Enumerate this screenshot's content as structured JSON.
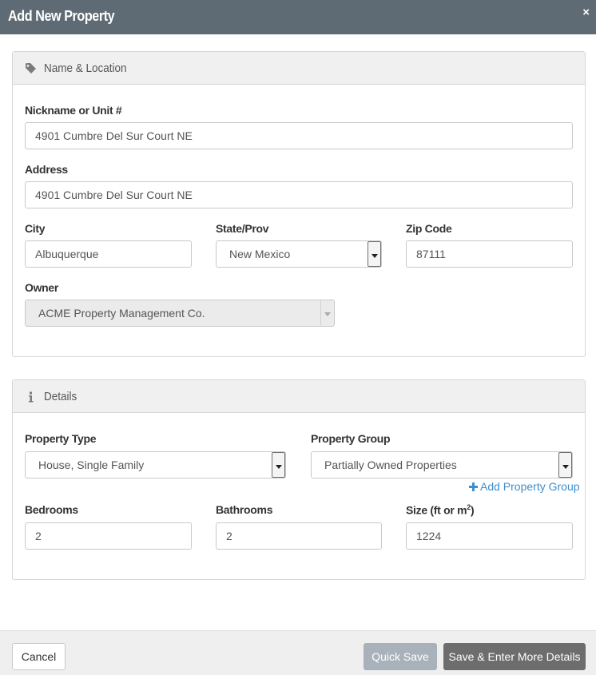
{
  "dialog": {
    "title": "Add New Property",
    "close_symbol": "×"
  },
  "section_location": {
    "title": "Name & Location",
    "icon": "tag-icon",
    "nickname": {
      "label": "Nickname or Unit #",
      "value": "4901 Cumbre Del Sur Court NE"
    },
    "address": {
      "label": "Address",
      "value": "4901 Cumbre Del Sur Court NE"
    },
    "city": {
      "label": "City",
      "value": "Albuquerque"
    },
    "state": {
      "label": "State/Prov",
      "value": "New Mexico"
    },
    "zip": {
      "label": "Zip Code",
      "value": "87111"
    },
    "owner": {
      "label": "Owner",
      "value": "ACME Property Management Co.",
      "disabled": true
    }
  },
  "section_details": {
    "title": "Details",
    "icon": "info-icon",
    "property_type": {
      "label": "Property Type",
      "value": "House, Single Family"
    },
    "property_group": {
      "label": "Property Group",
      "value": "Partially Owned Properties"
    },
    "add_group_link": "Add Property Group",
    "bedrooms": {
      "label": "Bedrooms",
      "value": "2"
    },
    "bathrooms": {
      "label": "Bathrooms",
      "value": "2"
    },
    "size": {
      "label_prefix": "Size (ft or m",
      "label_sup": "2",
      "label_suffix": ")",
      "value": "1224"
    }
  },
  "footer": {
    "cancel": "Cancel",
    "quick_save": "Quick Save",
    "save_more": "Save & Enter More Details"
  },
  "colors": {
    "titlebar": "#5f6b74",
    "link": "#3d8ed0",
    "quick_save_bg": "#a9b2ba",
    "save_bg": "#6d6d6d"
  }
}
